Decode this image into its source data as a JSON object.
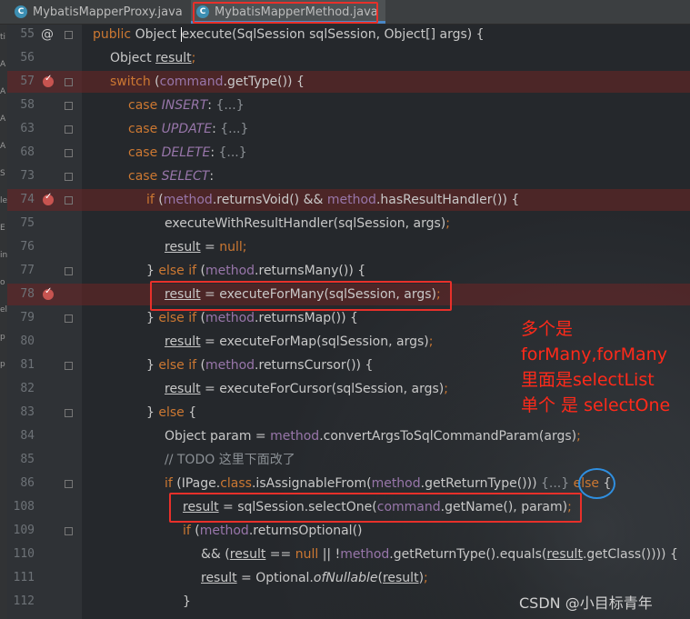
{
  "tabs": [
    {
      "label": "MybatisMapperProxy.java",
      "icon": "class-icon",
      "active": false
    },
    {
      "label": "MybatisMapperMethod.java",
      "icon": "class-icon",
      "active": true
    }
  ],
  "gutter": {
    "line_numbers": [
      "55",
      "56",
      "57",
      "58",
      "63",
      "68",
      "73",
      "74",
      "75",
      "76",
      "77",
      "78",
      "79",
      "80",
      "81",
      "82",
      "83",
      "84",
      "85",
      "86",
      "108",
      "109",
      "110",
      "111",
      "112"
    ],
    "override_marker": "@",
    "breakpoint_lines": [
      "57",
      "74",
      "78"
    ]
  },
  "code_lines": [
    [
      {
        "t": "public ",
        "c": "kw"
      },
      {
        "t": "Object "
      },
      {
        "t": "execute",
        "c": "cur"
      },
      {
        "t": "(SqlSession sqlSession, Object[] args) {"
      }
    ],
    [
      {
        "t": "Object "
      },
      {
        "t": "result",
        "c": "ul"
      },
      {
        "t": ";",
        "c": "kw"
      }
    ],
    [
      {
        "t": "switch ",
        "c": "kw"
      },
      {
        "t": "("
      },
      {
        "t": "command",
        "c": "fld"
      },
      {
        "t": ".getType()) {"
      }
    ],
    [
      {
        "t": "case ",
        "c": "kw"
      },
      {
        "t": "INSERT",
        "c": "en"
      },
      {
        "t": ": "
      },
      {
        "t": "{...}",
        "c": "fd"
      }
    ],
    [
      {
        "t": "case ",
        "c": "kw"
      },
      {
        "t": "UPDATE",
        "c": "en"
      },
      {
        "t": ": "
      },
      {
        "t": "{...}",
        "c": "fd"
      }
    ],
    [
      {
        "t": "case ",
        "c": "kw"
      },
      {
        "t": "DELETE",
        "c": "en"
      },
      {
        "t": ": "
      },
      {
        "t": "{...}",
        "c": "fd"
      }
    ],
    [
      {
        "t": "case ",
        "c": "kw"
      },
      {
        "t": "SELECT",
        "c": "en"
      },
      {
        "t": ":"
      }
    ],
    [
      {
        "t": "if ",
        "c": "kw"
      },
      {
        "t": "("
      },
      {
        "t": "method",
        "c": "fld"
      },
      {
        "t": ".returnsVoid() && "
      },
      {
        "t": "method",
        "c": "fld"
      },
      {
        "t": ".hasResultHandler()) {"
      }
    ],
    [
      {
        "t": "executeWithResultHandler(sqlSession, args)"
      },
      {
        "t": ";",
        "c": "kw"
      }
    ],
    [
      {
        "t": "result",
        "c": "ul"
      },
      {
        "t": " = "
      },
      {
        "t": "null",
        "c": "kw"
      },
      {
        "t": ";",
        "c": "kw"
      }
    ],
    [
      {
        "t": "} "
      },
      {
        "t": "else if ",
        "c": "kw"
      },
      {
        "t": "("
      },
      {
        "t": "method",
        "c": "fld"
      },
      {
        "t": ".returnsMany()) {"
      }
    ],
    [
      {
        "t": "result",
        "c": "ul"
      },
      {
        "t": " = executeForMany(sqlSession, args)"
      },
      {
        "t": ";",
        "c": "kw"
      }
    ],
    [
      {
        "t": "} "
      },
      {
        "t": "else if ",
        "c": "kw"
      },
      {
        "t": "("
      },
      {
        "t": "method",
        "c": "fld"
      },
      {
        "t": ".returnsMap()) {"
      }
    ],
    [
      {
        "t": "result",
        "c": "ul"
      },
      {
        "t": " = executeForMap(sqlSession, args)"
      },
      {
        "t": ";",
        "c": "kw"
      }
    ],
    [
      {
        "t": "} "
      },
      {
        "t": "else if ",
        "c": "kw"
      },
      {
        "t": "("
      },
      {
        "t": "method",
        "c": "fld"
      },
      {
        "t": ".returnsCursor()) {"
      }
    ],
    [
      {
        "t": "result",
        "c": "ul"
      },
      {
        "t": " = executeForCursor(sqlSession, args)"
      },
      {
        "t": ";",
        "c": "kw"
      }
    ],
    [
      {
        "t": "} "
      },
      {
        "t": "else ",
        "c": "kw"
      },
      {
        "t": "{"
      }
    ],
    [
      {
        "t": "Object param = "
      },
      {
        "t": "method",
        "c": "fld"
      },
      {
        "t": ".convertArgsToSqlCommandParam(args)"
      },
      {
        "t": ";",
        "c": "kw"
      }
    ],
    [
      {
        "t": "// TODO 这里下面改了",
        "c": "cm"
      }
    ],
    [
      {
        "t": "if ",
        "c": "kw"
      },
      {
        "t": "(IPage."
      },
      {
        "t": "class",
        "c": "kw"
      },
      {
        "t": ".isAssignableFrom("
      },
      {
        "t": "method",
        "c": "fld"
      },
      {
        "t": ".getReturnType())) "
      },
      {
        "t": "{...}",
        "c": "fd"
      },
      {
        "t": " "
      },
      {
        "t": "else",
        "c": "kw"
      },
      {
        "t": " {"
      }
    ],
    [
      {
        "t": "result",
        "c": "ul"
      },
      {
        "t": " = sqlSession.selectOne("
      },
      {
        "t": "command",
        "c": "fld"
      },
      {
        "t": ".getName(), param)"
      },
      {
        "t": ";",
        "c": "kw"
      }
    ],
    [
      {
        "t": "if ",
        "c": "kw"
      },
      {
        "t": "("
      },
      {
        "t": "method",
        "c": "fld"
      },
      {
        "t": ".returnsOptional()"
      }
    ],
    [
      {
        "t": "&& ("
      },
      {
        "t": "result",
        "c": "ul"
      },
      {
        "t": " == "
      },
      {
        "t": "null",
        "c": "kw"
      },
      {
        "t": " || !"
      },
      {
        "t": "method",
        "c": "fld"
      },
      {
        "t": ".getReturnType().equals("
      },
      {
        "t": "result",
        "c": "ul"
      },
      {
        "t": ".getClass()))) {"
      }
    ],
    [
      {
        "t": "result",
        "c": "ul"
      },
      {
        "t": " = Optional."
      },
      {
        "t": "ofNullable",
        "c": "sm"
      },
      {
        "t": "("
      },
      {
        "t": "result",
        "c": "ul"
      },
      {
        "t": ")"
      },
      {
        "t": ";",
        "c": "kw"
      }
    ],
    [
      {
        "t": "}"
      }
    ]
  ],
  "annotation_lines": [
    "多个是",
    "forMany,forMany",
    "里面是selectList",
    "单个 是 selectOne"
  ],
  "watermark": "CSDN @小目标青年",
  "left_strip_chars": [
    "ti",
    "A",
    "A",
    "A",
    "A",
    "S",
    "le",
    "E",
    "in",
    "o",
    "el",
    "p",
    "p"
  ],
  "colors": {
    "keyword": "#cc7832",
    "field": "#9876aa",
    "annotation": "#ff2a1a",
    "highlight_box": "#e8302a",
    "circle": "#2f8fe0"
  }
}
